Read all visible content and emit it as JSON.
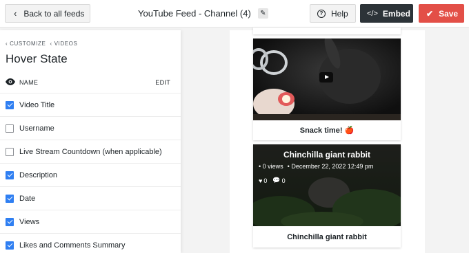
{
  "header": {
    "back_label": "Back to all feeds",
    "feed_title": "YouTube Feed - Channel (4)",
    "help_label": "Help",
    "embed_label": "Embed",
    "save_label": "Save"
  },
  "sidebar": {
    "breadcrumb": [
      "CUSTOMIZE",
      "VIDEOS"
    ],
    "title": "Hover State",
    "name_label": "NAME",
    "edit_label": "EDIT",
    "options": [
      {
        "label": "Video Title",
        "checked": true
      },
      {
        "label": "Username",
        "checked": false
      },
      {
        "label": "Live Stream Countdown (when applicable)",
        "checked": false
      },
      {
        "label": "Description",
        "checked": true
      },
      {
        "label": "Date",
        "checked": true
      },
      {
        "label": "Views",
        "checked": true
      },
      {
        "label": "Likes and Comments Summary",
        "checked": true
      }
    ]
  },
  "preview": {
    "videos": [
      {
        "title": "Snack time! 🍎"
      },
      {
        "title": "Chinchilla giant rabbit",
        "hover_title": "Chinchilla giant rabbit",
        "views": "0 views",
        "date": "December 22, 2022 12:49 pm",
        "likes": "0",
        "comments": "0"
      }
    ]
  },
  "colors": {
    "accent_blue": "#2f7ff2",
    "save_red": "#e34f47",
    "embed_dark": "#2c3338"
  }
}
